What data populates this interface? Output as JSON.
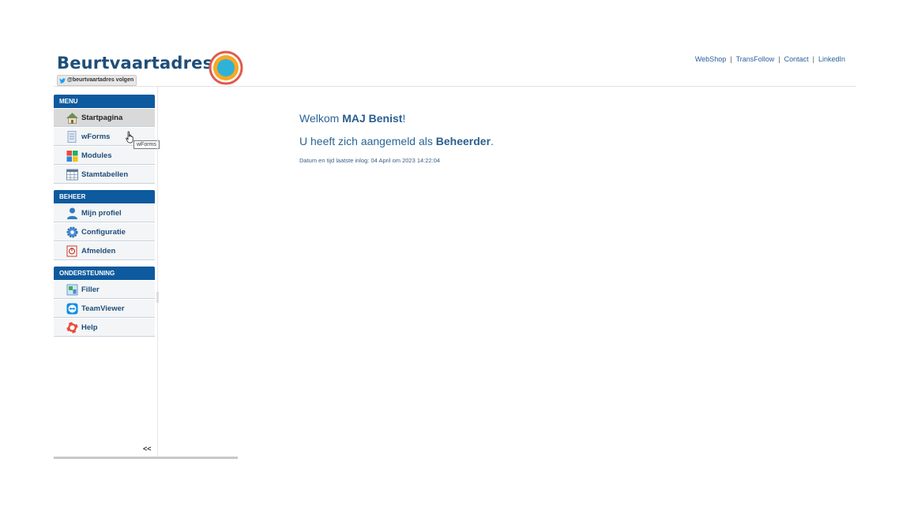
{
  "header": {
    "brand": "Beurtvaartadres",
    "twitter_follow": "@beurtvaartadres volgen",
    "links": [
      "WebShop",
      "TransFollow",
      "Contact",
      "LinkedIn"
    ],
    "separator": "|"
  },
  "sidebar": {
    "sections": [
      {
        "title": "MENU",
        "items": [
          {
            "label": "Startpagina",
            "icon": "home-icon"
          },
          {
            "label": "wForms",
            "icon": "forms-icon"
          },
          {
            "label": "Modules",
            "icon": "modules-icon"
          },
          {
            "label": "Stamtabellen",
            "icon": "table-icon"
          }
        ]
      },
      {
        "title": "BEHEER",
        "items": [
          {
            "label": "Mijn profiel",
            "icon": "user-icon"
          },
          {
            "label": "Configuratie",
            "icon": "gear-icon"
          },
          {
            "label": "Afmelden",
            "icon": "logout-icon"
          }
        ]
      },
      {
        "title": "ONDERSTEUNING",
        "items": [
          {
            "label": "Filler",
            "icon": "filler-icon"
          },
          {
            "label": "TeamViewer",
            "icon": "teamviewer-icon"
          },
          {
            "label": "Help",
            "icon": "help-icon"
          }
        ]
      }
    ],
    "collapse_label": "<<",
    "tooltip": "wForms"
  },
  "main": {
    "welcome_prefix": "Welkom ",
    "welcome_name": "MAJ Benist",
    "welcome_suffix": "!",
    "logged_prefix": "U heeft zich aangemeld als ",
    "role": "Beheerder",
    "logged_suffix": ".",
    "last_login": "Datum en tijd laatste inlog: 04 April om 2023 14:22:04"
  },
  "colors": {
    "section_header": "#0d5a9e",
    "link": "#2a5f9e",
    "brand": "#1f4e79"
  }
}
